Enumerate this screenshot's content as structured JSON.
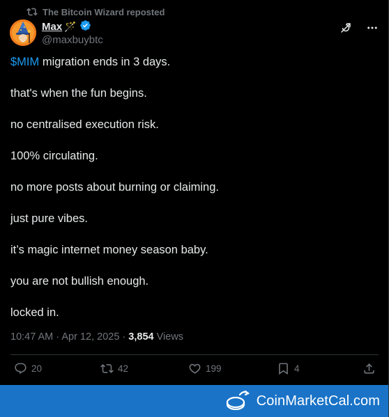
{
  "repost": {
    "text": "The Bitcoin Wizard reposted",
    "icon": "repost-icon"
  },
  "author": {
    "name": "Max",
    "emoji": "🪄",
    "handle": "@maxbuybtc",
    "verified": true,
    "verified_color": "#1d9bf0"
  },
  "post": {
    "cashtag": "$MIM",
    "first_line_rest": " migration ends in 3 days.",
    "lines": [
      "that's when the fun begins.",
      "no centralised execution risk.",
      "100% circulating.",
      "no more posts about burning or claiming.",
      "just pure vibes.",
      "it’s magic internet money season baby.",
      "you are not bullish enough.",
      "locked in."
    ]
  },
  "meta": {
    "time": "10:47 AM",
    "separator": " · ",
    "date": "Apr 12, 2025",
    "views_count": "3,854",
    "views_label": " Views"
  },
  "actions": {
    "replies": "20",
    "reposts": "42",
    "likes": "199",
    "bookmarks": "4"
  },
  "footer": {
    "brand": "CoinMarketCal.com",
    "background": "#1a73c7"
  },
  "colors": {
    "background": "#000000",
    "text": "#e7e9ea",
    "muted": "#71767b",
    "accent": "#1d9bf0"
  }
}
